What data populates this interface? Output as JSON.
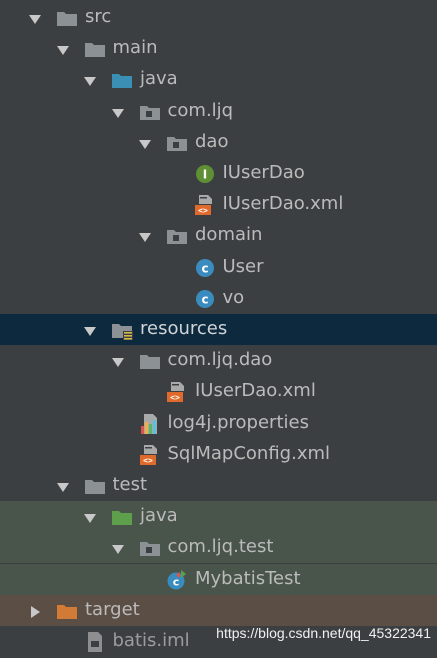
{
  "colors": {
    "background": "#3c3f41",
    "selected_row": "#0d293e",
    "test_root_row": "#49544a",
    "excluded_row": "#5b4e44",
    "folder": "#8c9196",
    "source_folder": "#3b8fb4",
    "resources_folder": "#8c9196",
    "test_folder": "#5e9f4b",
    "excluded_folder": "#d27b36",
    "package": "#8c9196",
    "interface_badge": "#5f8f34",
    "class_badge": "#3a8cbf",
    "xml_badge": "#e06a2c",
    "text": "#bbbbbb"
  },
  "tree": [
    {
      "label": "src",
      "icon": "folder-icon",
      "arrow": "expanded",
      "depth": 0
    },
    {
      "label": "main",
      "icon": "folder-icon",
      "arrow": "expanded",
      "depth": 1
    },
    {
      "label": "java",
      "icon": "source-folder-icon",
      "arrow": "expanded",
      "depth": 2
    },
    {
      "label": "com.ljq",
      "icon": "package-icon",
      "arrow": "expanded",
      "depth": 3
    },
    {
      "label": "dao",
      "icon": "package-icon",
      "arrow": "expanded",
      "depth": 4
    },
    {
      "label": "IUserDao",
      "icon": "interface-icon",
      "arrow": "none",
      "depth": 5
    },
    {
      "label": "IUserDao.xml",
      "icon": "xml-file-icon",
      "arrow": "none",
      "depth": 5
    },
    {
      "label": "domain",
      "icon": "package-icon",
      "arrow": "expanded",
      "depth": 4
    },
    {
      "label": "User",
      "icon": "class-icon",
      "arrow": "none",
      "depth": 5
    },
    {
      "label": "vo",
      "icon": "class-icon",
      "arrow": "none",
      "depth": 5
    },
    {
      "label": "resources",
      "icon": "resources-folder-icon",
      "arrow": "expanded",
      "depth": 2,
      "state": "selected"
    },
    {
      "label": "com.ljq.dao",
      "icon": "folder-icon",
      "arrow": "expanded",
      "depth": 3
    },
    {
      "label": "IUserDao.xml",
      "icon": "xml-file-icon",
      "arrow": "none",
      "depth": 4
    },
    {
      "label": "log4j.properties",
      "icon": "properties-file-icon",
      "arrow": "none",
      "depth": 3
    },
    {
      "label": "SqlMapConfig.xml",
      "icon": "xml-file-icon",
      "arrow": "none",
      "depth": 3
    },
    {
      "label": "test",
      "icon": "folder-icon",
      "arrow": "expanded",
      "depth": 1
    },
    {
      "label": "java",
      "icon": "test-source-folder-icon",
      "arrow": "expanded",
      "depth": 2,
      "state": "test-root"
    },
    {
      "label": "com.ljq.test",
      "icon": "package-icon",
      "arrow": "expanded",
      "depth": 3,
      "state": "test-root"
    },
    {
      "label": "MybatisTest",
      "icon": "test-class-icon",
      "arrow": "none",
      "depth": 4,
      "state": "test-root"
    },
    {
      "label": "target",
      "icon": "excluded-folder-icon",
      "arrow": "collapsed",
      "depth": 0,
      "state": "excluded"
    },
    {
      "label": "batis.iml",
      "icon": "module-file-icon",
      "arrow": "none",
      "depth": 1,
      "state": "faded"
    }
  ],
  "watermark": "https://blog.csdn.net/qq_45322341"
}
